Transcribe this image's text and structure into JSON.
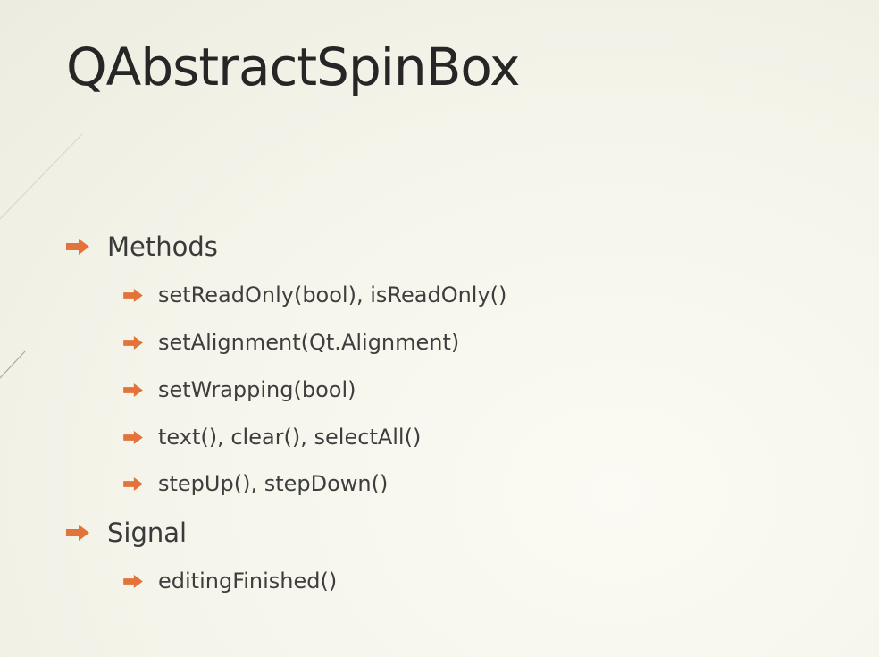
{
  "slide": {
    "title": "QAbstractSpinBox",
    "bullet_icon": "arrow-bullet-icon",
    "accent_color": "#e3733a",
    "sections": [
      {
        "label": "Methods",
        "items": [
          "setReadOnly(bool), isReadOnly()",
          "setAlignment(Qt.Alignment)",
          "setWrapping(bool)",
          "text(), clear(), selectAll()",
          "stepUp(), stepDown()"
        ]
      },
      {
        "label": "Signal",
        "items": [
          "editingFinished()"
        ]
      }
    ]
  }
}
